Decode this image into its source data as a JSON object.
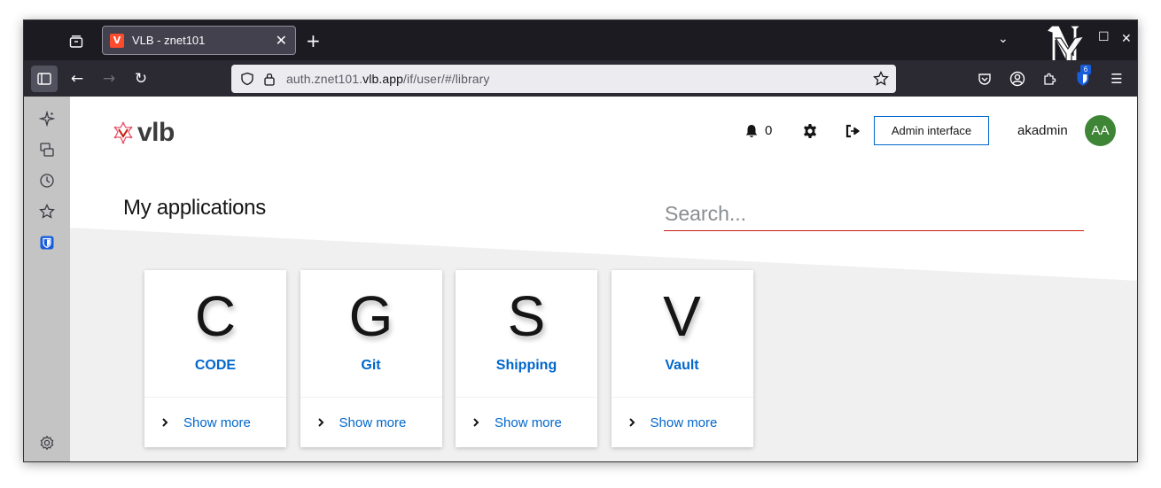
{
  "browser": {
    "tab_title": "VLB - znet101",
    "url_host_pre": "auth.znet101.",
    "url_host": "vlb.app",
    "url_path": "/if/user/#/library",
    "extension_badge": "6"
  },
  "header": {
    "logo_text": "vlb",
    "notification_count": "0",
    "admin_button_label": "Admin interface",
    "username": "akadmin",
    "avatar_initials": "AA"
  },
  "main": {
    "title": "My applications",
    "search_placeholder": "Search...",
    "apps": [
      {
        "letter": "C",
        "name": "CODE",
        "more_label": "Show more"
      },
      {
        "letter": "G",
        "name": "Git",
        "more_label": "Show more"
      },
      {
        "letter": "S",
        "name": "Shipping",
        "more_label": "Show more"
      },
      {
        "letter": "V",
        "name": "Vault",
        "more_label": "Show more"
      }
    ]
  },
  "colors": {
    "accent": "#0066cc",
    "avatar_bg": "#3e8635",
    "search_underline": "#c9190b",
    "logo_red": "#fd4b2d"
  },
  "icons": {
    "sidebar": [
      "ai-sparkle-icon",
      "sync-tabs-icon",
      "history-icon",
      "bookmarks-icon",
      "bitwarden-icon",
      "settings-icon"
    ]
  }
}
